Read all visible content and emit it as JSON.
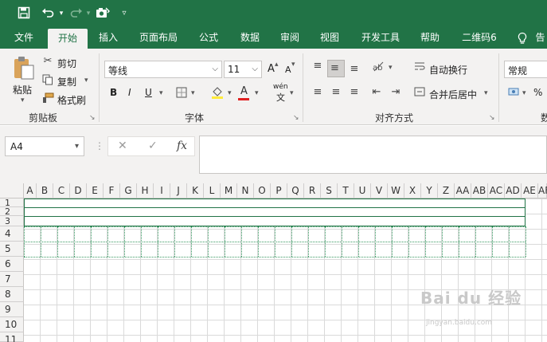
{
  "quick_access": {
    "save_icon": "save-icon",
    "undo_icon": "undo-icon",
    "redo_icon": "redo-icon",
    "custom_icon": "camera-icon",
    "customize_icon": "chevron-down-icon"
  },
  "tabs": [
    {
      "label": "文件"
    },
    {
      "label": "开始"
    },
    {
      "label": "插入"
    },
    {
      "label": "页面布局"
    },
    {
      "label": "公式"
    },
    {
      "label": "数据"
    },
    {
      "label": "审阅"
    },
    {
      "label": "视图"
    },
    {
      "label": "开发工具"
    },
    {
      "label": "帮助"
    },
    {
      "label": "二维码6"
    }
  ],
  "clipboard": {
    "paste_label": "粘贴",
    "cut_label": "剪切",
    "copy_label": "复制",
    "format_painter_label": "格式刷",
    "group_label": "剪贴板"
  },
  "font": {
    "font_name": "等线",
    "font_size": "11",
    "grow_label": "A",
    "shrink_label": "A",
    "bold_label": "B",
    "italic_label": "I",
    "underline_label": "U",
    "font_color_label": "A",
    "phonetic_label": "wén",
    "phonetic_sub": "文",
    "group_label": "字体"
  },
  "alignment": {
    "wrap_label": "自动换行",
    "merge_label": "合并后居中",
    "group_label": "对齐方式"
  },
  "number": {
    "format": "常规",
    "percent": "%",
    "group_label_partial": "数"
  },
  "formula_bar": {
    "name_box": "A4",
    "cancel_icon": "✕",
    "enter_icon": "✓",
    "fx_label": "fx"
  },
  "columns": [
    "A",
    "B",
    "C",
    "D",
    "E",
    "F",
    "G",
    "H",
    "I",
    "J",
    "K",
    "L",
    "M",
    "N",
    "O",
    "P",
    "Q",
    "R",
    "S",
    "T",
    "U",
    "V",
    "W",
    "X",
    "Y",
    "Z",
    "AA",
    "AB",
    "AC",
    "AD",
    "AE",
    "AF"
  ],
  "rows": [
    "1",
    "2",
    "3",
    "4",
    "5",
    "6",
    "7",
    "8",
    "9",
    "10",
    "11"
  ],
  "watermark": {
    "text": "Bai du 经验",
    "sub": "jingyan.baidu.com"
  },
  "colors": {
    "accent": "#217346",
    "ribbon_bg": "#f3f2f1"
  }
}
